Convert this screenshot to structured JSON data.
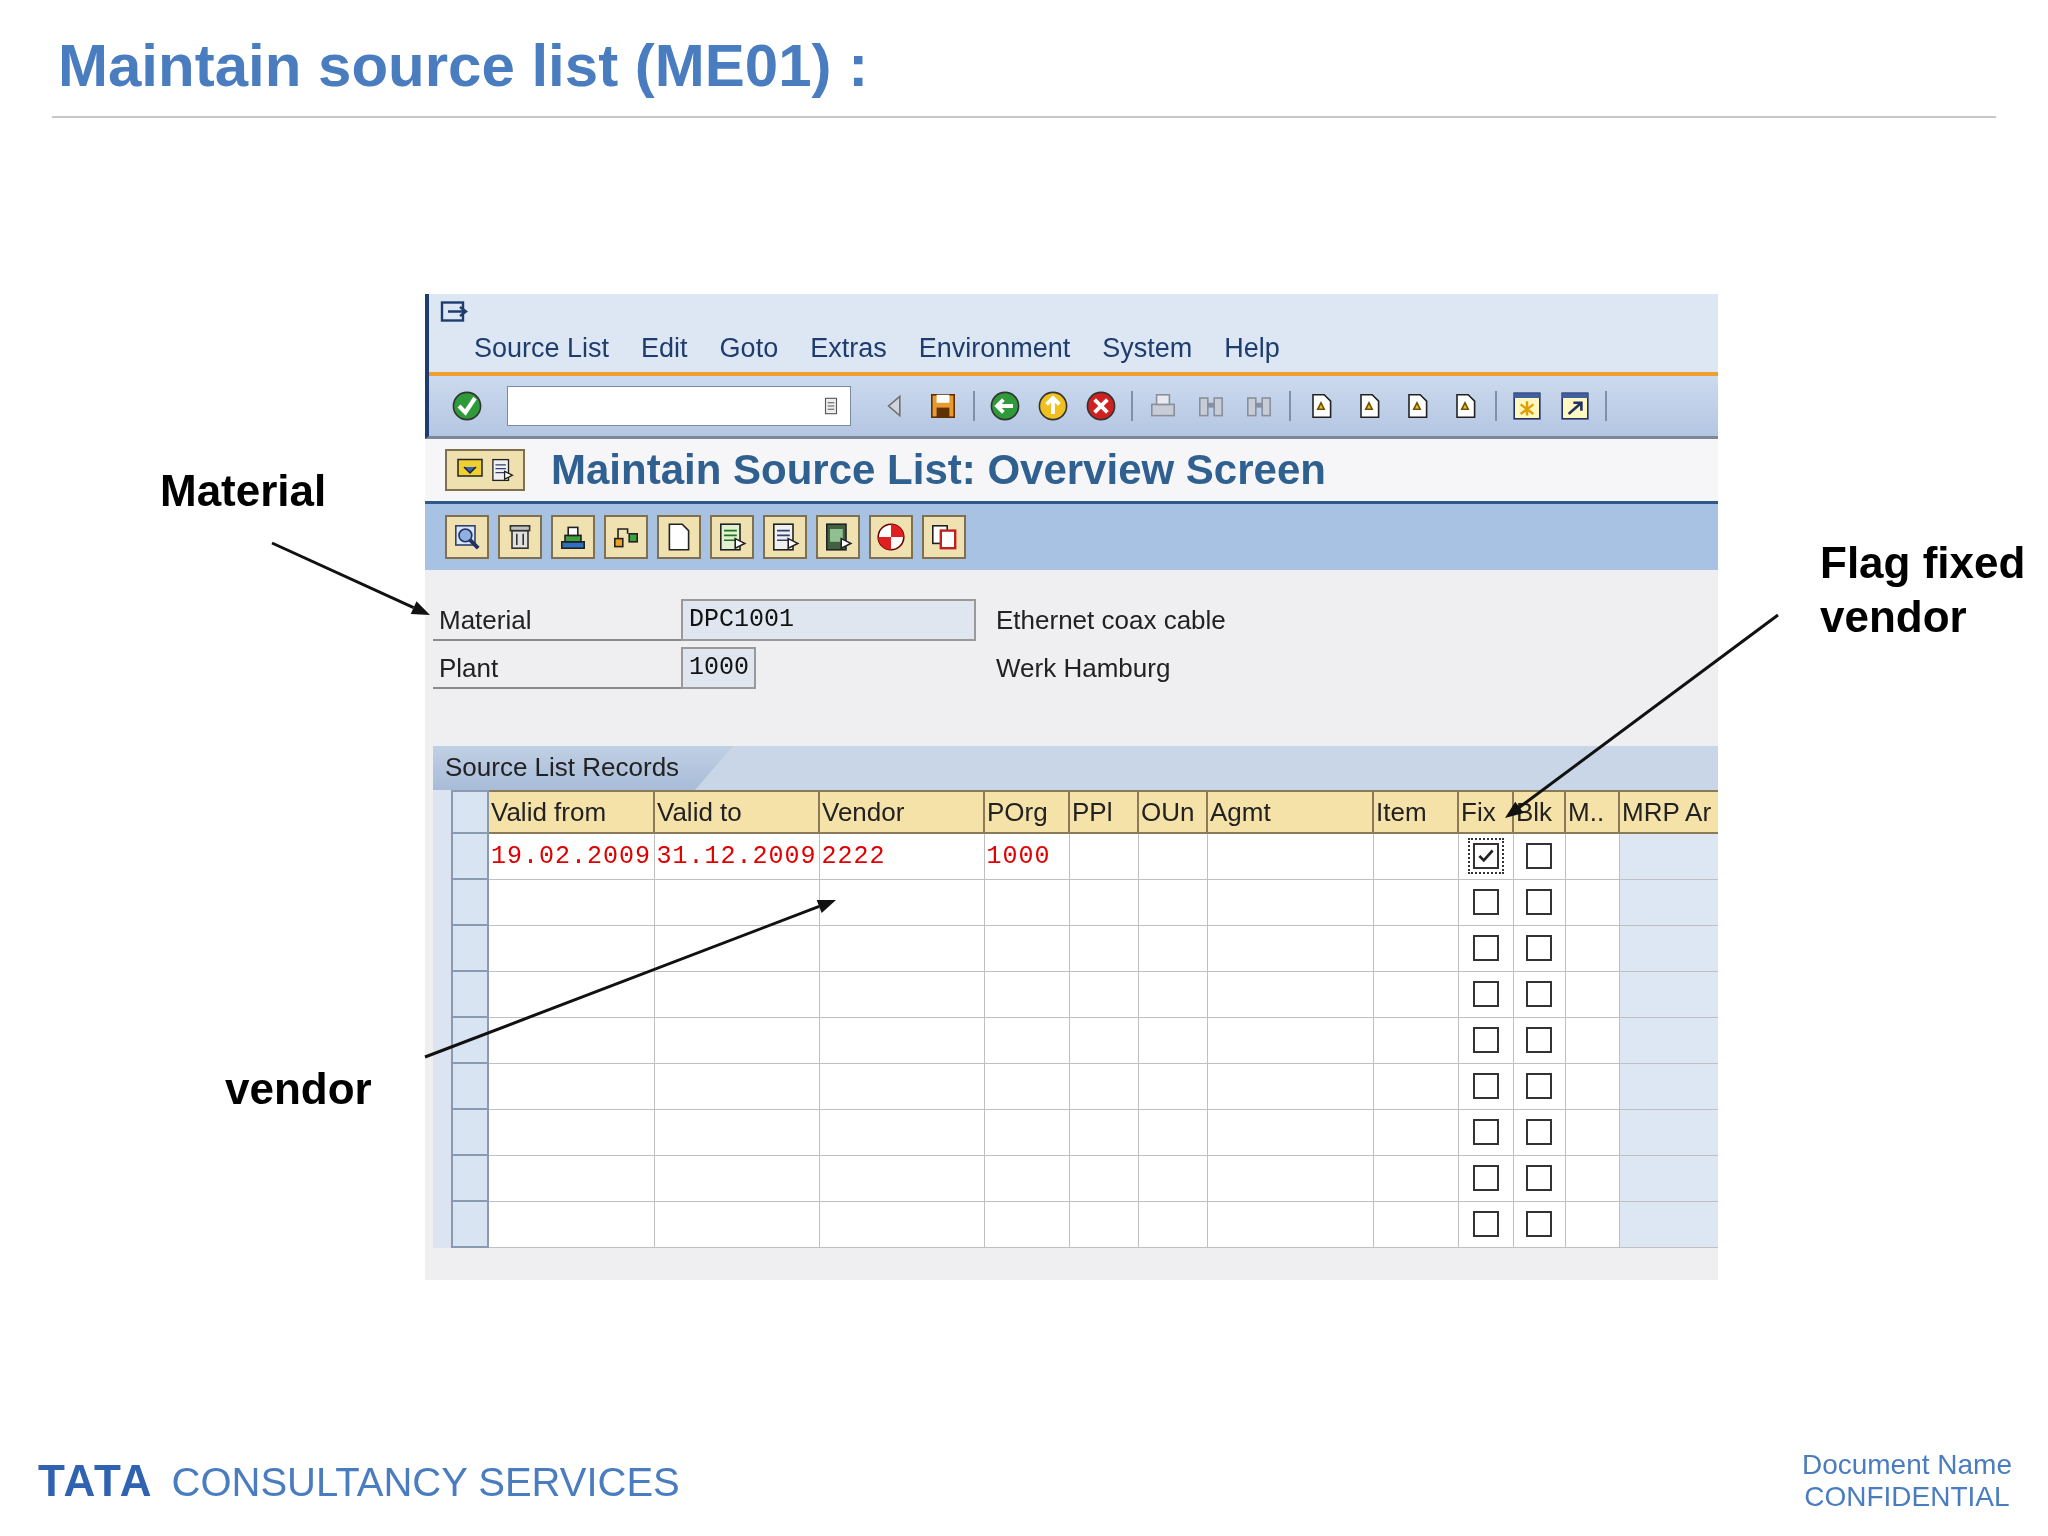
{
  "slide_title": "Maintain source list (ME01) :",
  "sap": {
    "menu": [
      "Source List",
      "Edit",
      "Goto",
      "Extras",
      "Environment",
      "System",
      "Help"
    ],
    "screen_title": "Maintain Source List: Overview Screen",
    "fields": [
      {
        "label": "Material",
        "value": "DPC1001",
        "description": "Ethernet coax cable",
        "kind": "wide"
      },
      {
        "label": "Plant",
        "value": "1000",
        "description": "Werk Hamburg",
        "kind": "narrow"
      }
    ],
    "table": {
      "tab": "Source List Records",
      "columns": [
        "Valid from",
        "Valid to",
        "Vendor",
        "POrg",
        "PPl",
        "OUn",
        "Agmt",
        "Item",
        "Fix",
        "Blk",
        "M..",
        "MRP Ar"
      ],
      "rows": [
        {
          "valid_from": "19.02.2009",
          "valid_to": "31.12.2009",
          "vendor": "2222",
          "porg": "1000",
          "fix_checked": true,
          "fix_focused": true,
          "blk_checked": false
        },
        {
          "fix_checked": false,
          "fix_focused": false,
          "blk_checked": false
        },
        {
          "fix_checked": false,
          "fix_focused": false,
          "blk_checked": false
        },
        {
          "fix_checked": false,
          "fix_focused": false,
          "blk_checked": false
        },
        {
          "fix_checked": false,
          "fix_focused": false,
          "blk_checked": false
        },
        {
          "fix_checked": false,
          "fix_focused": false,
          "blk_checked": false
        },
        {
          "fix_checked": false,
          "fix_focused": false,
          "blk_checked": false
        },
        {
          "fix_checked": false,
          "fix_focused": false,
          "blk_checked": false
        },
        {
          "fix_checked": false,
          "fix_focused": false,
          "blk_checked": false
        }
      ]
    }
  },
  "annotations": [
    {
      "text": "Material"
    },
    {
      "text": "Flag fixed vendor"
    },
    {
      "text": "vendor"
    }
  ],
  "footer": {
    "logo": "TATA",
    "company": "CONSULTANCY SERVICES",
    "document_name": "Document Name",
    "classification": "CONFIDENTIAL"
  }
}
